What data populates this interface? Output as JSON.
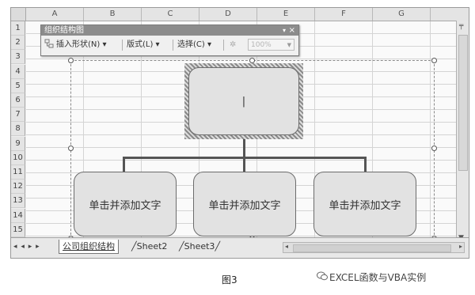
{
  "columns": [
    "A",
    "B",
    "C",
    "D",
    "E",
    "F",
    "G"
  ],
  "rows": [
    "1",
    "2",
    "3",
    "4",
    "5",
    "6",
    "7",
    "8",
    "9",
    "10",
    "11",
    "12",
    "13",
    "14",
    "15"
  ],
  "toolbar": {
    "title": "组织结构图",
    "menu_glyph": "▾",
    "close_glyph": "×",
    "insert_shape": "插入形状(N)",
    "layout": "版式(L)",
    "select": "选择(C)",
    "zoom_placeholder": "100%",
    "icons": [
      "insert-shape-icon",
      "autoformat-icon"
    ]
  },
  "org_chart": {
    "top_box_text": "|",
    "child_boxes": [
      "单击并添加文字",
      "单击并添加文字",
      "单击并添加文字"
    ]
  },
  "sheet_tabs": {
    "nav_glyphs": "◂ ◂ ▸ ▸",
    "tabs": [
      "公司组织结构",
      "Sheet2",
      "Sheet3"
    ],
    "active_index": 0
  },
  "caption": "图3",
  "watermark": "EXCEL函数与VBA实例"
}
